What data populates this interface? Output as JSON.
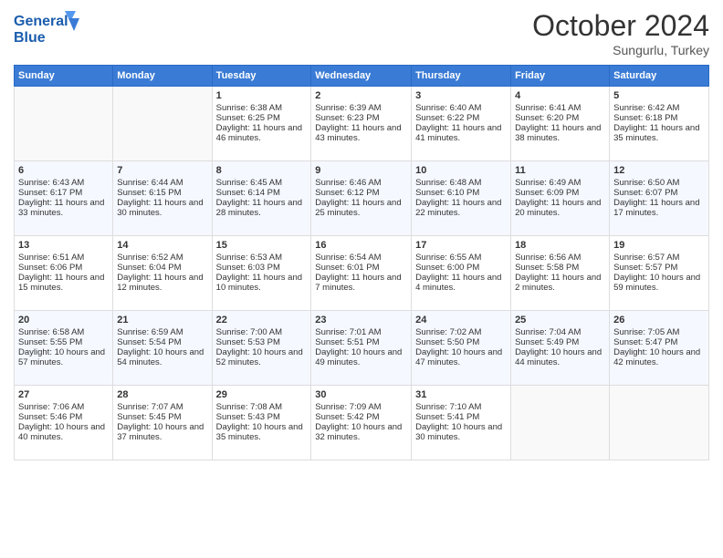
{
  "header": {
    "logo_line1": "General",
    "logo_line2": "Blue",
    "month": "October 2024",
    "location": "Sungurlu, Turkey"
  },
  "days_of_week": [
    "Sunday",
    "Monday",
    "Tuesday",
    "Wednesday",
    "Thursday",
    "Friday",
    "Saturday"
  ],
  "weeks": [
    [
      {
        "day": "",
        "empty": true
      },
      {
        "day": "",
        "empty": true
      },
      {
        "day": "1",
        "sunrise": "6:38 AM",
        "sunset": "6:25 PM",
        "daylight": "11 hours and 46 minutes."
      },
      {
        "day": "2",
        "sunrise": "6:39 AM",
        "sunset": "6:23 PM",
        "daylight": "11 hours and 43 minutes."
      },
      {
        "day": "3",
        "sunrise": "6:40 AM",
        "sunset": "6:22 PM",
        "daylight": "11 hours and 41 minutes."
      },
      {
        "day": "4",
        "sunrise": "6:41 AM",
        "sunset": "6:20 PM",
        "daylight": "11 hours and 38 minutes."
      },
      {
        "day": "5",
        "sunrise": "6:42 AM",
        "sunset": "6:18 PM",
        "daylight": "11 hours and 35 minutes."
      }
    ],
    [
      {
        "day": "6",
        "sunrise": "6:43 AM",
        "sunset": "6:17 PM",
        "daylight": "11 hours and 33 minutes."
      },
      {
        "day": "7",
        "sunrise": "6:44 AM",
        "sunset": "6:15 PM",
        "daylight": "11 hours and 30 minutes."
      },
      {
        "day": "8",
        "sunrise": "6:45 AM",
        "sunset": "6:14 PM",
        "daylight": "11 hours and 28 minutes."
      },
      {
        "day": "9",
        "sunrise": "6:46 AM",
        "sunset": "6:12 PM",
        "daylight": "11 hours and 25 minutes."
      },
      {
        "day": "10",
        "sunrise": "6:48 AM",
        "sunset": "6:10 PM",
        "daylight": "11 hours and 22 minutes."
      },
      {
        "day": "11",
        "sunrise": "6:49 AM",
        "sunset": "6:09 PM",
        "daylight": "11 hours and 20 minutes."
      },
      {
        "day": "12",
        "sunrise": "6:50 AM",
        "sunset": "6:07 PM",
        "daylight": "11 hours and 17 minutes."
      }
    ],
    [
      {
        "day": "13",
        "sunrise": "6:51 AM",
        "sunset": "6:06 PM",
        "daylight": "11 hours and 15 minutes."
      },
      {
        "day": "14",
        "sunrise": "6:52 AM",
        "sunset": "6:04 PM",
        "daylight": "11 hours and 12 minutes."
      },
      {
        "day": "15",
        "sunrise": "6:53 AM",
        "sunset": "6:03 PM",
        "daylight": "11 hours and 10 minutes."
      },
      {
        "day": "16",
        "sunrise": "6:54 AM",
        "sunset": "6:01 PM",
        "daylight": "11 hours and 7 minutes."
      },
      {
        "day": "17",
        "sunrise": "6:55 AM",
        "sunset": "6:00 PM",
        "daylight": "11 hours and 4 minutes."
      },
      {
        "day": "18",
        "sunrise": "6:56 AM",
        "sunset": "5:58 PM",
        "daylight": "11 hours and 2 minutes."
      },
      {
        "day": "19",
        "sunrise": "6:57 AM",
        "sunset": "5:57 PM",
        "daylight": "10 hours and 59 minutes."
      }
    ],
    [
      {
        "day": "20",
        "sunrise": "6:58 AM",
        "sunset": "5:55 PM",
        "daylight": "10 hours and 57 minutes."
      },
      {
        "day": "21",
        "sunrise": "6:59 AM",
        "sunset": "5:54 PM",
        "daylight": "10 hours and 54 minutes."
      },
      {
        "day": "22",
        "sunrise": "7:00 AM",
        "sunset": "5:53 PM",
        "daylight": "10 hours and 52 minutes."
      },
      {
        "day": "23",
        "sunrise": "7:01 AM",
        "sunset": "5:51 PM",
        "daylight": "10 hours and 49 minutes."
      },
      {
        "day": "24",
        "sunrise": "7:02 AM",
        "sunset": "5:50 PM",
        "daylight": "10 hours and 47 minutes."
      },
      {
        "day": "25",
        "sunrise": "7:04 AM",
        "sunset": "5:49 PM",
        "daylight": "10 hours and 44 minutes."
      },
      {
        "day": "26",
        "sunrise": "7:05 AM",
        "sunset": "5:47 PM",
        "daylight": "10 hours and 42 minutes."
      }
    ],
    [
      {
        "day": "27",
        "sunrise": "7:06 AM",
        "sunset": "5:46 PM",
        "daylight": "10 hours and 40 minutes."
      },
      {
        "day": "28",
        "sunrise": "7:07 AM",
        "sunset": "5:45 PM",
        "daylight": "10 hours and 37 minutes."
      },
      {
        "day": "29",
        "sunrise": "7:08 AM",
        "sunset": "5:43 PM",
        "daylight": "10 hours and 35 minutes."
      },
      {
        "day": "30",
        "sunrise": "7:09 AM",
        "sunset": "5:42 PM",
        "daylight": "10 hours and 32 minutes."
      },
      {
        "day": "31",
        "sunrise": "7:10 AM",
        "sunset": "5:41 PM",
        "daylight": "10 hours and 30 minutes."
      },
      {
        "day": "",
        "empty": true
      },
      {
        "day": "",
        "empty": true
      }
    ]
  ],
  "labels": {
    "sunrise": "Sunrise:",
    "sunset": "Sunset:",
    "daylight": "Daylight:"
  }
}
